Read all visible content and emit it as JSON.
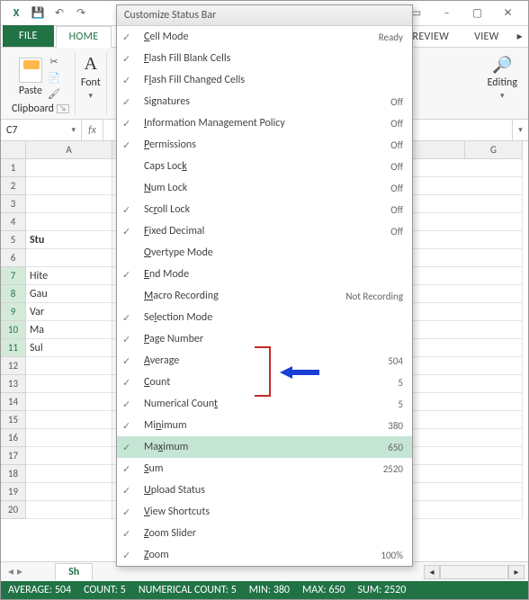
{
  "qat": {
    "save_title": "Save",
    "undo_title": "Undo",
    "redo_title": "Redo"
  },
  "win": {
    "help": "?",
    "min": "Minimize",
    "restore": "Restore",
    "close": "Close"
  },
  "tabs": {
    "file": "FILE",
    "home": "HOME",
    "review": "REVIEW",
    "view": "VIEW"
  },
  "ribbon": {
    "paste": "Paste",
    "clipboard": "Clipboard",
    "font": "Font",
    "editing": "Editing",
    "font_letter": "A"
  },
  "namebox": "C7",
  "columns": {
    "a": "A",
    "g": "G"
  },
  "rows": [
    "1",
    "2",
    "3",
    "4",
    "5",
    "6",
    "7",
    "8",
    "9",
    "10",
    "11",
    "12",
    "13",
    "14",
    "15",
    "16",
    "17",
    "18",
    "19",
    "20"
  ],
  "cells": {
    "a5": "Stu",
    "a7": "Hite",
    "a8": "Gau",
    "a9": "Var",
    "a10": "Ma",
    "a11": "Sul"
  },
  "sheet": {
    "name": "Sh"
  },
  "status": {
    "average": "AVERAGE: 504",
    "count": "COUNT: 5",
    "num_count": "NUMERICAL COUNT: 5",
    "min": "MIN: 380",
    "max": "MAX: 650",
    "sum": "SUM: 2520"
  },
  "ctx": {
    "title": "Customize Status Bar",
    "items": [
      {
        "checked": true,
        "u": "C",
        "label": "ell Mode",
        "val": "Ready",
        "name": "cell-mode"
      },
      {
        "checked": true,
        "u": "F",
        "label": "lash Fill Blank Cells",
        "val": "",
        "name": "flash-fill-blank"
      },
      {
        "checked": true,
        "u": "",
        "label": "F",
        "u2": "l",
        "post": "ash Fill Changed Cells",
        "val": "",
        "name": "flash-fill-changed"
      },
      {
        "checked": true,
        "u": "",
        "label": "Si",
        "u2": "g",
        "post": "natures",
        "val": "Off",
        "name": "signatures"
      },
      {
        "checked": true,
        "u": "I",
        "label": "nformation Management Policy",
        "val": "Off",
        "name": "info-mgmt"
      },
      {
        "checked": true,
        "u": "P",
        "label": "ermissions",
        "val": "Off",
        "name": "permissions"
      },
      {
        "checked": false,
        "u": "",
        "label": "Caps Loc",
        "u2": "k",
        "post": "",
        "val": "Off",
        "name": "caps-lock"
      },
      {
        "checked": false,
        "u": "N",
        "label": "um Lock",
        "val": "Off",
        "name": "num-lock"
      },
      {
        "checked": true,
        "u": "",
        "label": "Sc",
        "u2": "r",
        "post": "oll Lock",
        "val": "Off",
        "name": "scroll-lock"
      },
      {
        "checked": true,
        "u": "F",
        "label": "ixed Decimal",
        "val": "Off",
        "name": "fixed-decimal"
      },
      {
        "checked": false,
        "u": "O",
        "label": "vertype Mode",
        "val": "",
        "name": "overtype"
      },
      {
        "checked": true,
        "u": "E",
        "label": "nd Mode",
        "val": "",
        "name": "end-mode"
      },
      {
        "checked": false,
        "u": "M",
        "label": "acro Recording",
        "val": "Not Recording",
        "name": "macro-recording"
      },
      {
        "checked": true,
        "u": "",
        "label": "Se",
        "u2": "l",
        "post": "ection Mode",
        "val": "",
        "name": "selection-mode"
      },
      {
        "checked": true,
        "u": "P",
        "label": "age Number",
        "val": "",
        "name": "page-number"
      },
      {
        "checked": true,
        "u": "A",
        "label": "verage",
        "val": "504",
        "name": "average"
      },
      {
        "checked": true,
        "u": "C",
        "label": "ount",
        "val": "5",
        "name": "count"
      },
      {
        "checked": true,
        "u": "",
        "label": "Numerical Coun",
        "u2": "t",
        "post": "",
        "val": "5",
        "name": "numerical-count"
      },
      {
        "checked": true,
        "u": "",
        "label": "Mi",
        "u2": "n",
        "post": "imum",
        "val": "380",
        "name": "minimum"
      },
      {
        "checked": true,
        "u": "",
        "label": "Ma",
        "u2": "x",
        "post": "imum",
        "val": "650",
        "name": "maximum",
        "high": true
      },
      {
        "checked": true,
        "u": "S",
        "label": "um",
        "val": "2520",
        "name": "sum"
      },
      {
        "checked": true,
        "u": "U",
        "label": "pload Status",
        "val": "",
        "name": "upload-status"
      },
      {
        "checked": true,
        "u": "V",
        "label": "iew Shortcuts",
        "val": "",
        "name": "view-shortcuts"
      },
      {
        "checked": true,
        "u": "Z",
        "label": "oom Slider",
        "val": "",
        "name": "zoom-slider"
      },
      {
        "checked": true,
        "u": "Z",
        "label": "oom",
        "val": "100%",
        "name": "zoom"
      }
    ]
  }
}
